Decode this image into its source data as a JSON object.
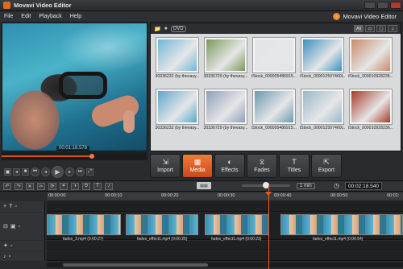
{
  "app": {
    "title": "Movavi Video Editor",
    "brand": "Movavi Video Editor"
  },
  "menu": [
    "File",
    "Edit",
    "Playback",
    "Help"
  ],
  "preview": {
    "timecode": "00:01:18.578",
    "progress": 0.62
  },
  "media_toolbar": {
    "dvd_label": "DVD",
    "view_all": "All"
  },
  "media_items": [
    {
      "caption": "30336232 (by thevasy...",
      "color": "#6fb7d8"
    },
    {
      "caption": "30336729 (by thevasy...",
      "color": "#7a9a5a"
    },
    {
      "caption": "iStock_000005486915...",
      "color": "#e0e6ea"
    },
    {
      "caption": "iStock_000012507460L...",
      "color": "#3a8fc0"
    },
    {
      "caption": "iStock_000010928236...",
      "color": "#c98a68"
    },
    {
      "caption": "30336232 (by thevasy...",
      "color": "#5aa8cc"
    },
    {
      "caption": "30336729 (by thevasy...",
      "color": "#8fa0b8"
    },
    {
      "caption": "iStock_000005486915...",
      "color": "#6a9ab0"
    },
    {
      "caption": "iStock_000012507460L...",
      "color": "#9ab8c8"
    },
    {
      "caption": "iStock_000010928236...",
      "color": "#a83a2a"
    }
  ],
  "tabs": [
    {
      "label": "Import",
      "icon": "import-icon",
      "glyph": "⇲",
      "active": false
    },
    {
      "label": "Media",
      "icon": "media-icon",
      "glyph": "▦",
      "active": true
    },
    {
      "label": "Effects",
      "icon": "effects-icon",
      "glyph": "◐",
      "active": false
    },
    {
      "label": "Fades",
      "icon": "fades-icon",
      "glyph": "⧖",
      "active": false
    },
    {
      "label": "Titles",
      "icon": "titles-icon",
      "glyph": "T",
      "active": false
    },
    {
      "label": "Export",
      "icon": "export-icon",
      "glyph": "⇱",
      "active": false
    }
  ],
  "timeline_toolbar": {
    "zoom_label": "1 min",
    "timecode": "00:02:18.540"
  },
  "ruler": [
    "00:00:00",
    "00:00:10",
    "00:00:20",
    "00:00:30",
    "00:00:40",
    "00:00:50",
    "00:01:"
  ],
  "clips": [
    {
      "caption": "fades_3.mp4 (0:00:27)"
    },
    {
      "caption": "fades_effect1.mp4 (0:00:25)"
    },
    {
      "caption": "fades_effect1.mp4 (0:00:23)"
    },
    {
      "caption": "fades_effect1.mp4 (0:00:54)"
    }
  ]
}
